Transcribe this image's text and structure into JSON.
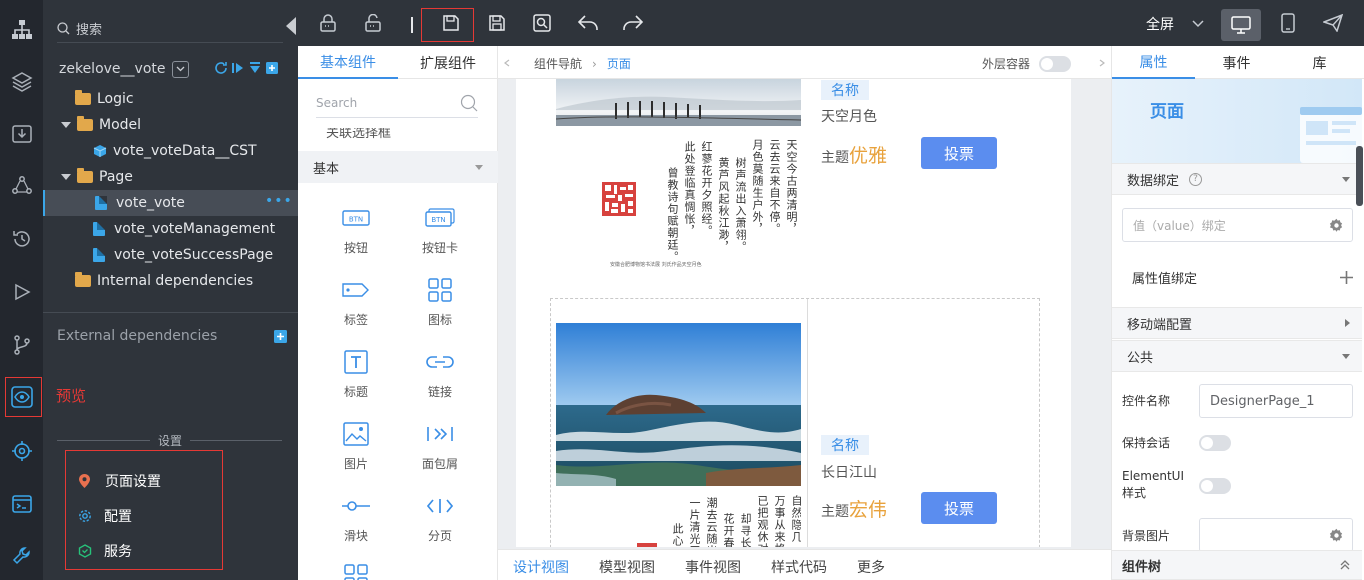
{
  "explorer": {
    "search_placeholder": "搜索",
    "project": "zekelove__vote",
    "tree": {
      "logic": "Logic",
      "model": "Model",
      "model_item": "vote_voteData__CST",
      "page": "Page",
      "page_items": [
        "vote_vote",
        "vote_voteManagement",
        "vote_voteSuccessPage"
      ],
      "internal": "Internal dependencies"
    },
    "external": "External dependencies",
    "preview_label": "预览",
    "settings_title": "设置",
    "settings_menu": [
      "页面设置",
      "配置",
      "服务"
    ]
  },
  "toolbar": {
    "save_label": "保存",
    "fullscreen": "全屏"
  },
  "components": {
    "tabs": [
      "基本组件",
      "扩展组件"
    ],
    "search_placeholder": "Search",
    "cut_item": "关联选择框",
    "group": "基本",
    "items": [
      "按钮",
      "按钮卡",
      "标签",
      "图标",
      "标题",
      "链接",
      "图片",
      "面包屑",
      "滑块",
      "分页"
    ],
    "btn_text": "BTN"
  },
  "canvas": {
    "breadcrumb": [
      "组件导航",
      "页面"
    ],
    "outer_container": "外层容器",
    "bottom_tabs": [
      "设计视图",
      "模型视图",
      "事件视图",
      "样式代码",
      "更多"
    ],
    "card1": {
      "name_tag": "名称",
      "name": "天空月色",
      "theme_label": "主题",
      "theme": "优雅",
      "vote": "投票",
      "poem": [
        "天空今古两清明，",
        "云去云来自不停。",
        "月色莫随生户外，",
        "树声流出入萧翎。",
        "黄芦风起秋江渺，",
        "红蓼花开夕照经。",
        "此处登临真惆怅，",
        "曾教诗句赋朝廷。"
      ],
      "caption": "安徽合肥博物馆书法展 刘氏作品天空月色"
    },
    "card2": {
      "name_tag": "名称",
      "name": "长日江山",
      "theme_label": "主题",
      "theme": "宏伟",
      "vote": "投票",
      "poem": [
        "自然隐几",
        "万事从来格外",
        "已把观休对",
        "却寻长日",
        "花开春",
        "潮去云随出",
        "一片清光天",
        "此心归"
      ]
    }
  },
  "props": {
    "tabs": [
      "属性",
      "事件",
      "库"
    ],
    "banner": "页面",
    "data_binding": "数据绑定",
    "value_binding_placeholder": "值（value）绑定",
    "attr_binding": "属性值绑定",
    "mobile_config": "移动端配置",
    "common": "公共",
    "control_name_label": "控件名称",
    "control_name_value": "DesignerPage_1",
    "keep_session": "保持会话",
    "elementui_style": "ElementUI样式",
    "bg_image": "背景图片",
    "component_tree": "组件树"
  },
  "colors": {
    "accent": "#3a8ee6",
    "annotation": "#e53935",
    "theme_text": "#e8a23c",
    "vote_button": "#5b8def"
  }
}
